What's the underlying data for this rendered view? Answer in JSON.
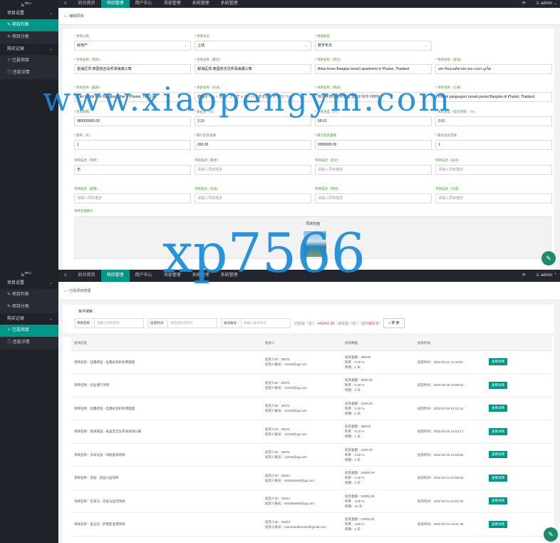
{
  "top": {
    "logo": {
      "text": "lc",
      "sup": "TPL3"
    },
    "sidebar": [
      {
        "type": "group",
        "label": "项目设置"
      },
      {
        "type": "item",
        "label": "项目列表",
        "active": true,
        "icon": "edit-icon"
      },
      {
        "type": "item",
        "label": "项目分类",
        "active": false,
        "icon": "edit-icon"
      },
      {
        "type": "group",
        "label": "购买记录"
      },
      {
        "type": "item",
        "label": "已投项目",
        "active": false,
        "icon": "flag-icon"
      },
      {
        "type": "item",
        "label": "还款详情",
        "active": false,
        "icon": "info-icon"
      }
    ],
    "nav": [
      "后台首页",
      "项目管理",
      "用户中心",
      "消息管理",
      "系统管理",
      "系统管理"
    ],
    "nav_selected": 1,
    "user": "admin",
    "breadcrumb": "编辑项目",
    "form_rows": [
      [
        {
          "label": "项目分类",
          "req": true,
          "value": "房地产",
          "select": true
        },
        {
          "label": "项目状态",
          "req": true,
          "value": "上线",
          "select": true
        },
        {
          "label": "周期类型",
          "req": true,
          "value": "数字年日",
          "select": true
        },
        null
      ],
      [
        {
          "label": "项目名称（简体）",
          "req": true,
          "value": "银海区项-泰国普吉岛邦涛海滩公寓"
        },
        {
          "label": "项目名称（繁体）",
          "req": true,
          "value": "銀海區項-泰國普吉島邦濤海灘公寓"
        },
        {
          "label": "项目名称（英文）",
          "req": true,
          "value": "Bihai home Bangtao beach apartment in Phuket, Thailand"
        },
        {
          "label": "项目名称（泰语）",
          "req": true,
          "value": "อพาร์ทเมนต์ชายหาดบางเทา ภูเก็ต"
        }
      ],
      [
        {
          "label": "项目名称（越南）",
          "req": true,
          "value": "Căn hộ bãi biển Bangtao Bihai ở Phuket, Thái Lan"
        },
        {
          "label": "项目名称（日语）",
          "req": true,
          "value": "碧海ホーム・タイ・プーケット・バンタオビーチアパート"
        },
        {
          "label": "项目名称（韩语）",
          "req": true,
          "value": "태국 푸켓의 비하이 홈 방타오 비치 아파트"
        },
        {
          "label": "项目名称（马来）",
          "req": true,
          "value": "Projek pangsapuri rumah pantai Bangtao di Phuket, Thailand"
        }
      ],
      [
        {
          "label": "项目规模",
          "req": true,
          "value": "980000000.00"
        },
        {
          "label": "收益率（%）",
          "req": true,
          "value": "3.10"
        },
        {
          "label": "项目进度（%）",
          "req": true,
          "value": "68.01"
        },
        {
          "label": "项目进度（投资到期）（%）",
          "req": true,
          "value": "0.01"
        }
      ],
      [
        {
          "label": "期限（天）",
          "req": true,
          "value": "1"
        },
        {
          "label": "最小投资金额",
          "req": true,
          "value": "399.00"
        },
        {
          "label": "最大投资金额",
          "req": true,
          "value": "9999999.00"
        },
        {
          "label": "最大投资次数",
          "req": true,
          "value": "1"
        }
      ],
      [
        {
          "label": "项目描述（简体）",
          "req": false,
          "value": "无"
        },
        {
          "label": "项目描述（繁体）",
          "req": false,
          "value": "请输入项目描述",
          "ph": true
        },
        {
          "label": "项目描述（英文）",
          "req": false,
          "value": "请输入项目描述",
          "ph": true
        },
        {
          "label": "项目描述（泰语）",
          "req": false,
          "value": "请输入项目描述",
          "ph": true
        }
      ],
      [
        {
          "label": "项目描述（越南）",
          "req": false,
          "value": "请输入项目描述",
          "ph": true
        },
        {
          "label": "项目描述（日语）",
          "req": false,
          "value": "请输入项目描述",
          "ph": true
        },
        {
          "label": "项目描述（韩语）",
          "req": false,
          "value": "请输入项目描述",
          "ph": true
        },
        {
          "label": "项目描述（马来）",
          "req": false,
          "value": "请输入项目描述",
          "ph": true
        }
      ]
    ],
    "upload_label": "项目封面图片",
    "upload_title": "项目封面"
  },
  "bottom": {
    "logo": {
      "text": "lc",
      "sup": "TPL3"
    },
    "sidebar": [
      {
        "type": "group",
        "label": "项目设置"
      },
      {
        "type": "item",
        "label": "项目列表",
        "active": false,
        "icon": "edit-icon"
      },
      {
        "type": "item",
        "label": "项目分类",
        "active": false,
        "icon": "edit-icon"
      },
      {
        "type": "group",
        "label": "购买记录"
      },
      {
        "type": "item",
        "label": "已投项目",
        "active": true,
        "icon": "flag-icon"
      },
      {
        "type": "item",
        "label": "还款详情",
        "active": false,
        "icon": "info-icon"
      }
    ],
    "nav": [
      "后台首页",
      "项目管理",
      "用户中心",
      "消息管理",
      "系统管理",
      "系统管理"
    ],
    "nav_selected": 1,
    "user": "admin",
    "breadcrumb": "已投项目管理",
    "search": {
      "title": "条件搜索",
      "fields": [
        {
          "key": "项目名称",
          "placeholder": "请输入项目名称"
        },
        {
          "key": "投资时间",
          "placeholder": "请选择投资时间"
        },
        {
          "key": "会员账号",
          "placeholder": "请输入会员账号"
        }
      ],
      "earned_label": "已收益（总）：",
      "earned_value": "442457.99",
      "unearned_label": "未收益（总）：",
      "unearned_value": "1273820.97",
      "button": "搜 索"
    },
    "table": {
      "headers": [
        "投资信息",
        "投资人",
        "投资数据",
        "投资时间",
        ""
      ],
      "rows": [
        {
          "project": "项目名称：桂鑫把垣 - 桂鑫投资机构港理理",
          "uid": "投资人ID：34571",
          "account": "投资人账号：12345@qq.com",
          "amount": "投资金额：399.00",
          "rate": "利率：3.20 %",
          "period": "周期：1 天",
          "time": "投资时间：2022-04-12 11:19:01",
          "btn": "查看详情"
        },
        {
          "project": "项目名称：农业储气项目",
          "uid": "投资人ID：34571",
          "account": "投资人账号：12345@qq.com",
          "amount": "投资金额：5000.00",
          "rate": "利率：5.00 %",
          "period": "周期：2 天",
          "time": "投资时间：2022-03-28 15:59:54",
          "btn": "查看详情"
        },
        {
          "project": "项目名称：桂鑫把垣 - 桂鑫投资机构港理理",
          "uid": "投资人ID：34571",
          "account": "投资人账号：12345@qq.com",
          "amount": "投资金额：1000.00",
          "rate": "利率：3.20 %",
          "period": "周期：1 天",
          "time": "投资时间：2022-03-28 01:01:41",
          "btn": "查看详情"
        },
        {
          "project": "项目名称：银海家园 - 泰国普吉岛邦涛海滩公寓",
          "uid": "投资人ID：34571",
          "account": "投资人账号：12345@qq.com",
          "amount": "投资金额：399.00",
          "rate": "利率：3.10 %",
          "period": "周期：1 天",
          "time": "投资时间：2022-02-15 14:53:17",
          "btn": "查看详情"
        },
        {
          "project": "项目名称：多米尼加 - 绿能能源项目",
          "uid": "投资人ID：34571",
          "account": "投资人账号：12345@qq.com",
          "amount": "投资金额：1200.00",
          "rate": "利率：4.50 %",
          "period": "周期：7 天",
          "time": "投资时间：2022-02-15 14:53:05",
          "btn": "查看详情"
        },
        {
          "project": "项目名称：首园 - 首园公益项目",
          "uid": "投资人ID：34614",
          "account": "投资人账号：924455468@qq.com",
          "amount": "投资金额：15000.00",
          "rate": "利率：4.30 %",
          "period": "周期：3 天",
          "time": "投资时间：2022-02-14 23:55:03",
          "btn": "查看详情"
        },
        {
          "project": "项目名称：巴拿马 - 巴拿马运河项目",
          "uid": "投资人ID：34614",
          "account": "投资人账号：924455468@qq.com",
          "amount": "投资金额：50000.00",
          "rate": "利率：4.90 %",
          "period": "周期：15 天",
          "time": "投资时间：2022-02-14 23:52:39",
          "btn": "查看详情"
        },
        {
          "project": "项目名称：金豆拉 - 萨摩亚渔港项目",
          "uid": "投资人ID：34623",
          "account": "投资人账号：manmandemand@gmail.com",
          "amount": "投资金额：10000.00",
          "rate": "利率：4.80 %",
          "period": "周期：3 天",
          "time": "投资时间：2022-02-14 19:41:39",
          "btn": "查看详情"
        },
        {
          "project": "",
          "uid": "",
          "account": "",
          "amount": "投资金额：1000.00",
          "rate": "",
          "period": "",
          "time": "",
          "btn": ""
        }
      ]
    }
  },
  "watermarks": [
    "www.xiaopengym.com",
    "xp7566"
  ]
}
